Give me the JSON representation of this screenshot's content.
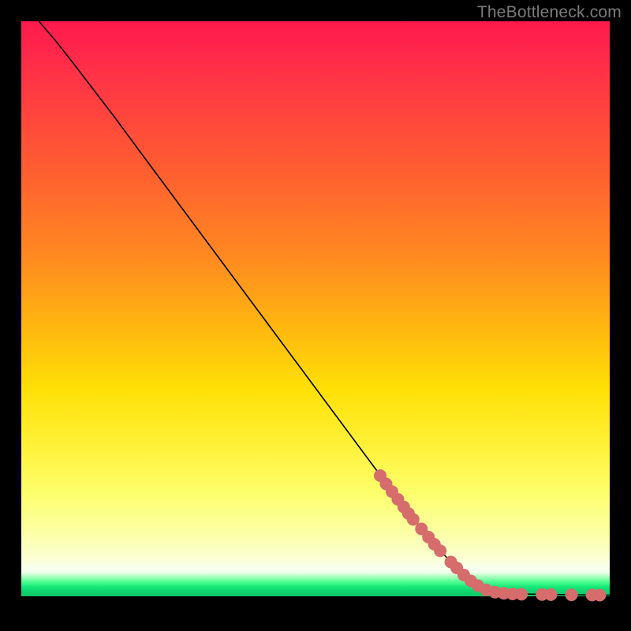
{
  "watermark": "TheBottleneck.com",
  "chart_data": {
    "type": "line",
    "title": "",
    "xlabel": "",
    "ylabel": "",
    "xlim": [
      0,
      100
    ],
    "ylim": [
      0,
      100
    ],
    "grid": false,
    "legend": false,
    "curve": {
      "name": "bottleneck-curve",
      "color": "#000000",
      "points": [
        {
          "x": 3.0,
          "y": 100.0
        },
        {
          "x": 6.0,
          "y": 96.5
        },
        {
          "x": 9.0,
          "y": 92.7
        },
        {
          "x": 12.0,
          "y": 88.8
        },
        {
          "x": 16.0,
          "y": 83.6
        },
        {
          "x": 20.0,
          "y": 78.2
        },
        {
          "x": 25.0,
          "y": 71.5
        },
        {
          "x": 30.0,
          "y": 64.8
        },
        {
          "x": 35.0,
          "y": 58.1
        },
        {
          "x": 40.0,
          "y": 51.4
        },
        {
          "x": 45.0,
          "y": 44.7
        },
        {
          "x": 50.0,
          "y": 38.0
        },
        {
          "x": 55.0,
          "y": 31.3
        },
        {
          "x": 60.0,
          "y": 24.6
        },
        {
          "x": 65.0,
          "y": 18.0
        },
        {
          "x": 70.0,
          "y": 11.8
        },
        {
          "x": 75.0,
          "y": 6.5
        },
        {
          "x": 80.0,
          "y": 3.7
        },
        {
          "x": 85.0,
          "y": 3.2
        },
        {
          "x": 90.0,
          "y": 3.1
        },
        {
          "x": 95.0,
          "y": 3.05
        },
        {
          "x": 100.0,
          "y": 3.0
        }
      ]
    },
    "markers": {
      "name": "highlight-dots",
      "color": "#d66c6c",
      "radius": 8,
      "points": [
        {
          "x": 61.0,
          "y": 23.2
        },
        {
          "x": 62.0,
          "y": 21.8
        },
        {
          "x": 63.0,
          "y": 20.5
        },
        {
          "x": 64.0,
          "y": 19.2
        },
        {
          "x": 65.0,
          "y": 17.9
        },
        {
          "x": 65.8,
          "y": 16.8
        },
        {
          "x": 66.6,
          "y": 15.8
        },
        {
          "x": 68.0,
          "y": 14.2
        },
        {
          "x": 69.2,
          "y": 12.8
        },
        {
          "x": 70.2,
          "y": 11.6
        },
        {
          "x": 71.2,
          "y": 10.5
        },
        {
          "x": 73.0,
          "y": 8.6
        },
        {
          "x": 74.0,
          "y": 7.6
        },
        {
          "x": 75.2,
          "y": 6.4
        },
        {
          "x": 76.4,
          "y": 5.4
        },
        {
          "x": 77.6,
          "y": 4.6
        },
        {
          "x": 79.0,
          "y": 3.9
        },
        {
          "x": 80.5,
          "y": 3.5
        },
        {
          "x": 82.0,
          "y": 3.3
        },
        {
          "x": 83.5,
          "y": 3.2
        },
        {
          "x": 85.0,
          "y": 3.15
        },
        {
          "x": 88.5,
          "y": 3.1
        },
        {
          "x": 90.0,
          "y": 3.08
        },
        {
          "x": 93.5,
          "y": 3.05
        },
        {
          "x": 97.0,
          "y": 3.02
        },
        {
          "x": 98.3,
          "y": 3.0
        }
      ]
    }
  }
}
